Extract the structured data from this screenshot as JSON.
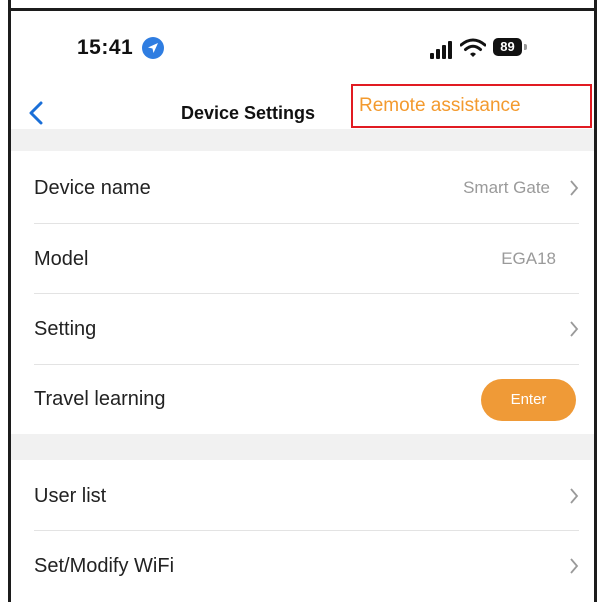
{
  "status_bar": {
    "time": "15:41",
    "battery": "89",
    "icons": [
      "location-arrow-icon",
      "signal-bars-icon",
      "wifi-icon",
      "battery-icon"
    ]
  },
  "nav": {
    "title": "Device Settings",
    "remote_assistance": "Remote assistance",
    "back_icon": "chevron-left-icon"
  },
  "rows": {
    "device_name": {
      "label": "Device name",
      "value": "Smart Gate"
    },
    "model": {
      "label": "Model",
      "value": "EGA18"
    },
    "setting": {
      "label": "Setting"
    },
    "travel_learning": {
      "label": "Travel learning",
      "button": "Enter"
    },
    "user_list": {
      "label": "User list"
    },
    "wifi": {
      "label": "Set/Modify WiFi"
    }
  },
  "colors": {
    "accent": "#ef9a37",
    "highlight_border": "#e11b22",
    "section_gap": "#f1f1f1"
  }
}
